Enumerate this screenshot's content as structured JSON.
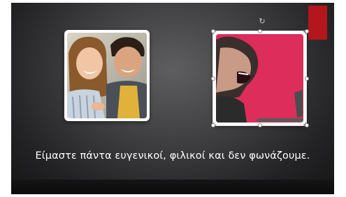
{
  "slide": {
    "caption": "Είμαστε πάντα ευγενικοί, φιλικοί και δεν φωνάζουμε.",
    "background_color": "#2b2b2d",
    "accent_color": "#b3161c",
    "images": [
      {
        "name": "happy-couple-photo",
        "selected": false
      },
      {
        "name": "shouting-man-photo",
        "selected": true,
        "background_color": "#e0305c"
      }
    ],
    "rotate_icon": "↻"
  }
}
